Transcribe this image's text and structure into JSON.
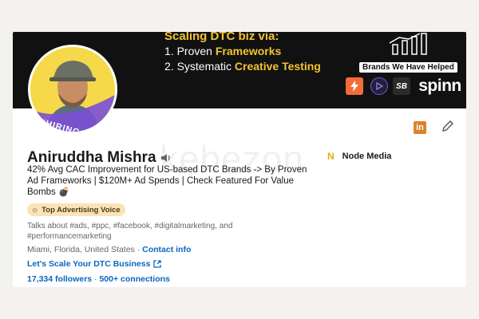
{
  "banner": {
    "headline": "Scaling DTC biz via:",
    "line1_prefix": "1. Proven ",
    "line1_highlight": "Frameworks",
    "line2_prefix": "2. Systematic ",
    "line2_highlight": "Creative Testing",
    "brands_label": "Brands We Have Helped",
    "brand_sb": "SB",
    "brand_spinn": "spinn"
  },
  "avatar": {
    "hiring": "#HIRING"
  },
  "profile": {
    "name": "Aniruddha Mishra",
    "company_name": "Node Media",
    "company_logo": "N",
    "headline": "42% Avg CAC Improvement for US-based DTC Brands -> By Proven Ad Frameworks | $120M+ Ad Spends | Check Featured For Value Bombs 💣",
    "badge": "Top Advertising Voice",
    "talks_about": "Talks about #ads, #ppc, #facebook, #digitalmarketing, and #performancemarketing",
    "location": "Miami, Florida, United States · ",
    "contact_info": "Contact info",
    "website_link": "Let's Scale Your DTC Business",
    "followers": "17,334 followers",
    "connections": "500+ connections"
  },
  "icons": {
    "linkedin": "in",
    "growth": "growth-chart-icon",
    "speaker": "speaker-icon",
    "edit": "pencil-icon",
    "external_link": "external-link-icon"
  },
  "watermark": "kebezon",
  "colors": {
    "accent_blue": "#0a66c2",
    "banner_yellow": "#f4c430",
    "badge_bg": "#fbe3b8"
  }
}
